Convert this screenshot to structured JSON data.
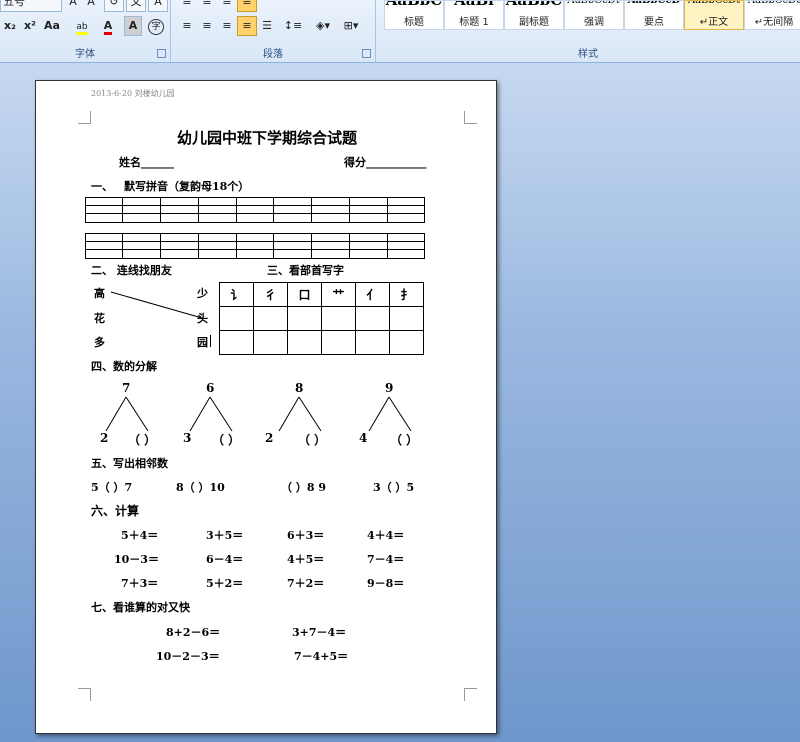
{
  "ribbon": {
    "font_group_label": "字体",
    "paragraph_group_label": "段落",
    "styles_group_label": "样式",
    "font_size_value": "五号",
    "subscript": "x₂",
    "superscript": "x²",
    "change_case": "Aa",
    "highlight_label": "ab",
    "font_color_label": "A",
    "char_shading": "A",
    "enclose_char": "字",
    "styles": [
      {
        "preview": "AaBbC",
        "label": "标题"
      },
      {
        "preview": "AaBl",
        "label": "标题 1"
      },
      {
        "preview": "AaBbC",
        "label": "副标题"
      },
      {
        "preview": "AaBbCcDt",
        "label": "强调"
      },
      {
        "preview": "AaBbCcD",
        "label": "要点"
      },
      {
        "preview": "AaBbCcDt",
        "label": "↵正文"
      },
      {
        "preview": "AaBbCcDt",
        "label": "↵无间隔"
      }
    ]
  },
  "document": {
    "header": "2013-6-20 刘楼幼儿园",
    "title": "幼儿园中班下学期综合试题",
    "name_label": "姓名______",
    "score_label": "得分___________",
    "s1_num": "一、",
    "s1_title": "默写拼音（复韵母18个）",
    "s2_title": "二、  连线找朋友",
    "s3_title": "三、看部首写字",
    "match_left": [
      "高",
      "花",
      "多"
    ],
    "match_right": [
      "少",
      "头",
      "园"
    ],
    "radicals": [
      "讠",
      "彳",
      "口",
      "艹",
      "亻",
      "扌"
    ],
    "s4_title": "四、数的分解",
    "decomp": [
      {
        "top": "7",
        "left": "2",
        "right": "（    ）"
      },
      {
        "top": "6",
        "left": "3",
        "right": "（    ）"
      },
      {
        "top": "8",
        "left": "2",
        "right": "（    ）"
      },
      {
        "top": "9",
        "left": "4",
        "right": "（    ）"
      }
    ],
    "s5_title": "五、写出相邻数",
    "neighbors": [
      "5（    ）7",
      "8（    ）10",
      "（    ）8  9",
      "3（    ）5"
    ],
    "s6_title": "六、计算",
    "calc_rows": [
      [
        "5＋4＝",
        "3＋5＝",
        "6＋3＝",
        "4＋4＝"
      ],
      [
        "10－3＝",
        "6－4＝",
        "4＋5＝",
        "7－4＝"
      ],
      [
        "7＋3＝",
        "5＋2＝",
        "7＋2＝",
        "9－8＝"
      ]
    ],
    "s7_title": "七、看谁算的对又快",
    "fast_rows": [
      [
        "8+2－6＝",
        "3+7－4＝"
      ],
      [
        "10－2－3＝",
        "7－4+5＝"
      ]
    ]
  }
}
